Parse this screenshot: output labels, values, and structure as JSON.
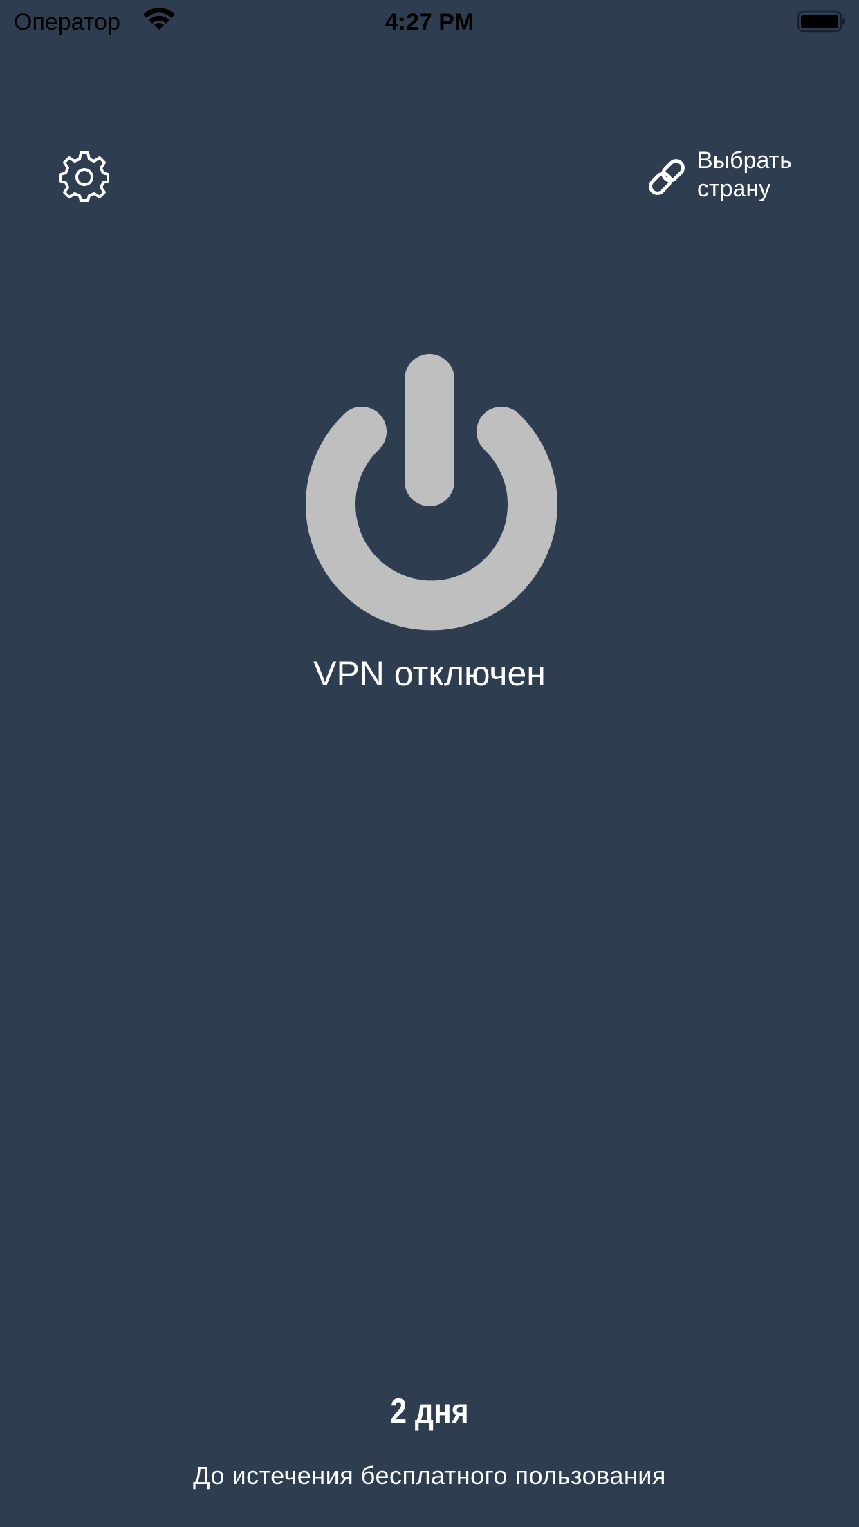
{
  "status_bar": {
    "carrier": "Оператор",
    "time": "4:27 PM",
    "wifi_icon": "wifi-icon",
    "battery_icon": "battery-icon"
  },
  "toolbar": {
    "settings_icon": "gear-icon",
    "country_icon": "link-icon",
    "country_label": "Выбрать страну"
  },
  "main": {
    "power_icon": "power-icon",
    "vpn_status": "VPN отключен"
  },
  "footer": {
    "days_left": "2 дня",
    "trial_caption": "До истечения бесплатного пользования"
  },
  "colors": {
    "background": "#2e3d50",
    "power_icon": "#bfbfbf",
    "text": "#ffffff"
  }
}
